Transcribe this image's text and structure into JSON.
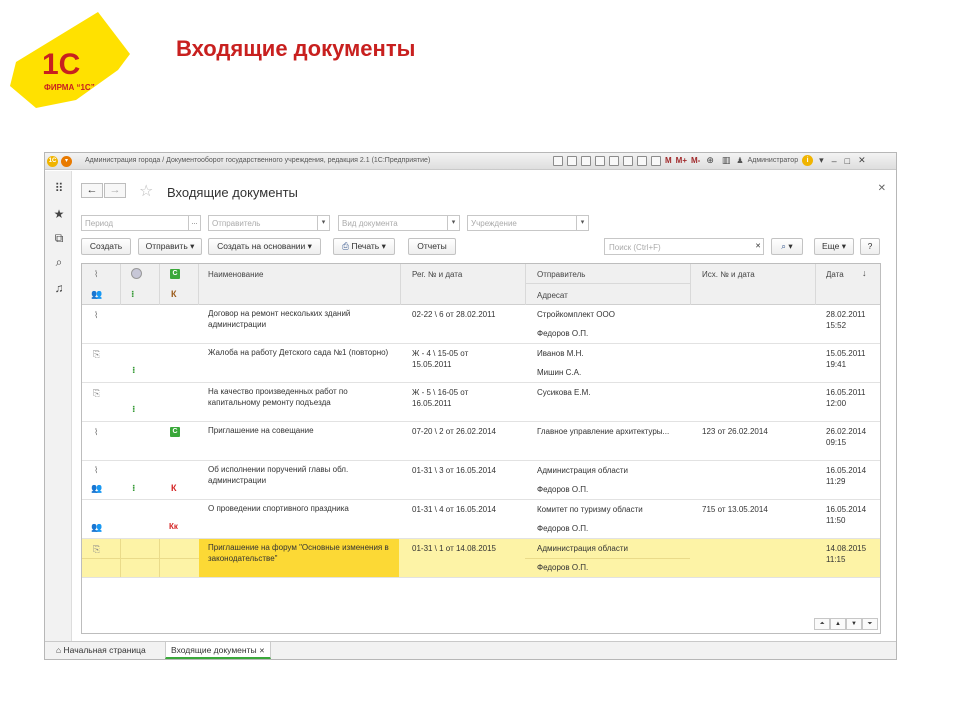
{
  "slide": {
    "title": "Входящие документы",
    "logo_text": "ФИРМА “1С”",
    "logo_mark": "1С"
  },
  "window": {
    "caption": "Администрация города / Документооборот государственного учреждения, редакция 2.1  (1С:Предприятие)",
    "user": "Администратор",
    "toolbar_letters": [
      "M",
      "M+",
      "M-"
    ]
  },
  "form": {
    "title": "Входящие документы",
    "filters": {
      "period": "Период",
      "sender": "Отправитель",
      "doc_type": "Вид документа",
      "org": "Учреждение"
    },
    "buttons": {
      "create": "Создать",
      "send": "Отправить",
      "create_based": "Создать на основании",
      "print": "Печать",
      "reports": "Отчеты",
      "more": "Еще",
      "help": "?"
    },
    "search_placeholder": "Поиск (Ctrl+F)"
  },
  "table": {
    "headers": {
      "name": "Наименование",
      "reg": "Рег. № и дата",
      "sender": "Отправитель",
      "addressee": "Адресат",
      "out": "Исх. № и дата",
      "date": "Дата",
      "k": "К",
      "c": "С"
    },
    "rows": [
      {
        "name": "Договор на ремонт нескольких зданий администрации",
        "reg": "02-22 \\ 6 от 28.02.2011",
        "sender": "Стройкомплект ООО",
        "addressee": "Федоров О.П.",
        "out": "",
        "date": "28.02.2011",
        "time": "15:52"
      },
      {
        "name": "Жалоба на работу Детского сада №1 (повторно)",
        "reg": "Ж - 4 \\ 15-05 от 15.05.2011",
        "sender": "Иванов М.Н.",
        "addressee": "Мишин С.А.",
        "out": "",
        "date": "15.05.2011",
        "time": "19:41"
      },
      {
        "name": "На качество произведенных работ по капитальному ремонту подъезда",
        "reg": "Ж - 5 \\ 16-05 от 16.05.2011",
        "sender": "Сусикова Е.М.",
        "addressee": "",
        "out": "",
        "date": "16.05.2011",
        "time": "12:00"
      },
      {
        "name": "Приглашение на совещание",
        "reg": "07-20 \\ 2 от 26.02.2014",
        "sender": "Главное управление архитектуры...",
        "addressee": "",
        "out": "123 от 26.02.2014",
        "date": "26.02.2014",
        "time": "09:15"
      },
      {
        "name": "Об исполнении поручений главы обл. администрации",
        "reg": "01-31 \\ 3 от 16.05.2014",
        "sender": "Администрация области",
        "addressee": "Федоров О.П.",
        "out": "",
        "date": "16.05.2014",
        "time": "11:29"
      },
      {
        "name": "О проведении спортивного праздника",
        "reg": "01-31 \\ 4 от 16.05.2014",
        "sender": "Комитет по туризму области",
        "addressee": "Федоров О.П.",
        "out": "715 от 13.05.2014",
        "date": "16.05.2014",
        "time": "11:50"
      },
      {
        "name": "Приглашение на форум \"Основные изменения в законодательстве\"",
        "reg": "01-31 \\ 1 от 14.08.2015",
        "sender": "Администрация области",
        "addressee": "Федоров О.П.",
        "out": "",
        "date": "14.08.2015",
        "time": "11:15"
      }
    ]
  },
  "tabs": {
    "home": "Начальная страница",
    "current": "Входящие документы"
  },
  "colors": {
    "title_red": "#c8201f",
    "selection": "#fdf3a6",
    "selection_cell": "#fcd935",
    "logo_yellow": "#ffe100"
  }
}
